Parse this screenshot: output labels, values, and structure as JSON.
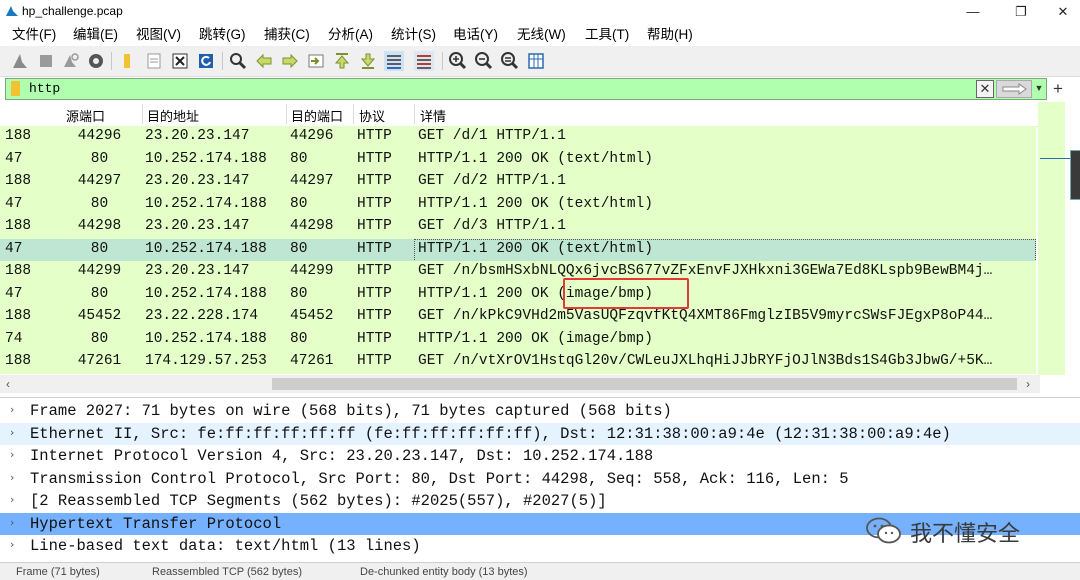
{
  "window": {
    "title": "hp_challenge.pcap",
    "controls": {
      "minimize": "—",
      "restore": "❐",
      "close": "✕"
    }
  },
  "menu": [
    "文件(F)",
    "编辑(E)",
    "视图(V)",
    "跳转(G)",
    "捕获(C)",
    "分析(A)",
    "统计(S)",
    "电话(Y)",
    "无线(W)",
    "工具(T)",
    "帮助(H)"
  ],
  "toolbar": {
    "icons": [
      "shark-fin-start-icon",
      "stop-capture-icon",
      "restart-capture-icon",
      "capture-options-icon",
      "open-file-icon",
      "save-file-icon",
      "close-file-icon",
      "reload-file-icon",
      "find-packet-icon",
      "go-back-icon",
      "go-forward-icon",
      "go-to-packet-icon",
      "first-packet-icon",
      "last-packet-icon",
      "autoscroll-icon",
      "colorize-icon",
      "zoom-in-icon",
      "zoom-out-icon",
      "zoom-normal-icon",
      "resize-columns-icon"
    ]
  },
  "filter": {
    "value": "http",
    "apply_icon": "arrow-right-icon",
    "add_label": "+"
  },
  "packet_list": {
    "columns": [
      "源端口",
      "目的地址",
      "目的端口",
      "协议",
      "详情"
    ],
    "rows": [
      {
        "src": "188",
        "sport": "44296",
        "dst": "23.20.23.147",
        "dport": "44296",
        "proto": "HTTP",
        "info": "GET /d/1 HTTP/1.1"
      },
      {
        "src": "47",
        "sport": "80",
        "dst": "10.252.174.188",
        "dport": "80",
        "proto": "HTTP",
        "info": "HTTP/1.1 200 OK  (text/html)"
      },
      {
        "src": "188",
        "sport": "44297",
        "dst": "23.20.23.147",
        "dport": "44297",
        "proto": "HTTP",
        "info": "GET /d/2 HTTP/1.1"
      },
      {
        "src": "47",
        "sport": "80",
        "dst": "10.252.174.188",
        "dport": "80",
        "proto": "HTTP",
        "info": "HTTP/1.1 200 OK  (text/html)"
      },
      {
        "src": "188",
        "sport": "44298",
        "dst": "23.20.23.147",
        "dport": "44298",
        "proto": "HTTP",
        "info": "GET /d/3 HTTP/1.1"
      },
      {
        "src": "47",
        "sport": "80",
        "dst": "10.252.174.188",
        "dport": "80",
        "proto": "HTTP",
        "info": "HTTP/1.1 200 OK  (text/html)",
        "selected": true
      },
      {
        "src": "188",
        "sport": "44299",
        "dst": "23.20.23.147",
        "dport": "44299",
        "proto": "HTTP",
        "info": "GET /n/bsmHSxbNLQQx6jvcBS677vZFxEnvFJXHkxni3GEWa7Ed8KLspb9BewBM4j…"
      },
      {
        "src": "47",
        "sport": "80",
        "dst": "10.252.174.188",
        "dport": "80",
        "proto": "HTTP",
        "info": "HTTP/1.1 200 OK  (image/bmp)"
      },
      {
        "src": "188",
        "sport": "45452",
        "dst": "23.22.228.174",
        "dport": "45452",
        "proto": "HTTP",
        "info": "GET /n/kPkC9VHd2m5VasUQFzqvfKtQ4XMT86FmglzIB5V9myrcSWsFJEgxP8oP44…"
      },
      {
        "src": "74",
        "sport": "80",
        "dst": "10.252.174.188",
        "dport": "80",
        "proto": "HTTP",
        "info": "HTTP/1.1 200 OK  (image/bmp)"
      },
      {
        "src": "188",
        "sport": "47261",
        "dst": "174.129.57.253",
        "dport": "47261",
        "proto": "HTTP",
        "info": "GET /n/vtXrOV1HstqGl20v/CWLeuJXLhqHiJJbRYFjOJlN3Bds1S4Gb3JbwG/+5K…"
      }
    ]
  },
  "details": [
    {
      "text": "Frame 2027: 71 bytes on wire (568 bits), 71 bytes captured (568 bits)",
      "style": ""
    },
    {
      "text": "Ethernet II, Src: fe:ff:ff:ff:ff:ff (fe:ff:ff:ff:ff:ff), Dst: 12:31:38:00:a9:4e (12:31:38:00:a9:4e)",
      "style": "alt"
    },
    {
      "text": "Internet Protocol Version 4, Src: 23.20.23.147, Dst: 10.252.174.188",
      "style": ""
    },
    {
      "text": "Transmission Control Protocol, Src Port: 80, Dst Port: 44298, Seq: 558, Ack: 116, Len: 5",
      "style": ""
    },
    {
      "text": "[2 Reassembled TCP Segments (562 bytes): #2025(557), #2027(5)]",
      "style": ""
    },
    {
      "text": "Hypertext Transfer Protocol",
      "style": "selected"
    },
    {
      "text": "Line-based text data: text/html (13 lines)",
      "style": ""
    }
  ],
  "watermark": {
    "text": "我不懂安全",
    "icon": "wechat-icon"
  },
  "status_tabs": [
    "Frame (71 bytes)",
    "Reassembled TCP (562 bytes)",
    "De-chunked entity body (13 bytes)"
  ],
  "colors": {
    "row_bg": "#e4ffc7",
    "selected_row": "#bfe6d3",
    "filter_bg": "#afffaf",
    "detail_selected": "#76b1ff",
    "highlight_box": "#e53935"
  }
}
